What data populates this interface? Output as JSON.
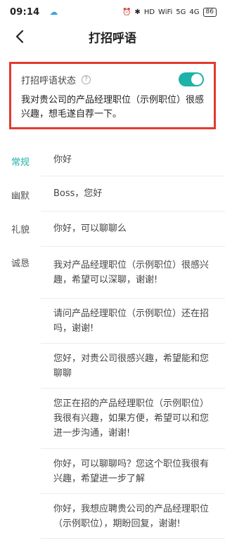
{
  "status_bar": {
    "time": "09:14",
    "cloud_icon": "cloud-icon",
    "indicators": [
      "⏰",
      "✱",
      "HD",
      "WiFi",
      "5G",
      "4G"
    ],
    "battery": "86"
  },
  "header": {
    "title": "打招呼语",
    "back_icon": "chevron-left-icon"
  },
  "greeting_card": {
    "label": "打招呼语状态",
    "help_icon": "question-icon",
    "help_glyph": "?",
    "toggle_on": true,
    "accent": "#1fb2a8",
    "highlight_border": "#e23b2e",
    "message": "我对贵公司的产品经理职位（示例职位）很感兴趣，想毛遂自荐一下。"
  },
  "categories": [
    {
      "label": "常规",
      "active": true
    },
    {
      "label": "幽默",
      "active": false
    },
    {
      "label": "礼貌",
      "active": false
    },
    {
      "label": "诚恳",
      "active": false
    }
  ],
  "phrases": [
    "你好",
    "Boss，您好",
    "你好，可以聊聊么",
    "我对产品经理职位（示例职位）很感兴趣，希望可以深聊，谢谢!",
    "请问产品经理职位（示例职位）还在招吗，谢谢!",
    "您好，对贵公司很感兴趣，希望能和您聊聊",
    "您正在招的产品经理职位（示例职位）我很有兴趣，如果方便，希望可以和您进一步沟通，谢谢!",
    "你好，可以聊聊吗？您这个职位我很有兴趣，希望进一步了解",
    "你好，我想应聘贵公司的产品经理职位（示例职位），期盼回复，谢谢!"
  ]
}
